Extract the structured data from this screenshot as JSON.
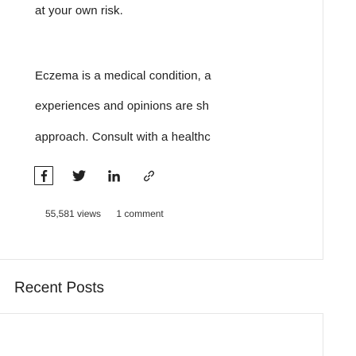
{
  "post": {
    "disclaimer_end": "at your own risk.",
    "paragraph_line1": "Eczema is a medical condition, a",
    "paragraph_line2": "experiences and opinions are sh",
    "paragraph_line3": "approach. Consult with a healthc"
  },
  "share": {
    "icons": [
      "facebook-icon",
      "twitter-icon",
      "linkedin-icon",
      "copy-link-icon"
    ]
  },
  "meta": {
    "views": "55,581 views",
    "comments": "1 comment"
  },
  "sidebar": {
    "recent_posts_title": "Recent Posts"
  }
}
